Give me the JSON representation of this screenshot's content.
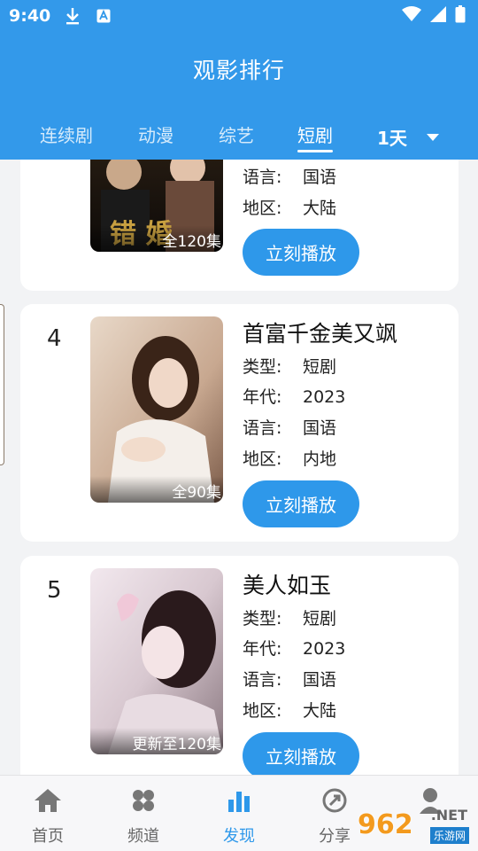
{
  "status_bar": {
    "time": "9:40"
  },
  "header": {
    "title": "观影排行"
  },
  "tabs": [
    {
      "label": "连续剧",
      "active": false
    },
    {
      "label": "动漫",
      "active": false
    },
    {
      "label": "综艺",
      "active": false
    },
    {
      "label": "短剧",
      "active": true
    }
  ],
  "period": {
    "label": "1天"
  },
  "items": [
    {
      "rank": "",
      "title": "",
      "type_label": "",
      "type": "",
      "year_label": "",
      "year": "",
      "lang_label": "语言:",
      "lang": "国语",
      "region_label": "地区:",
      "region": "大陆",
      "episodes": "全120集",
      "play_label": "立刻播放",
      "poster_text": "错 婚"
    },
    {
      "rank": "4",
      "title": "首富千金美又飒",
      "type_label": "类型:",
      "type": "短剧",
      "year_label": "年代:",
      "year": "2023",
      "lang_label": "语言:",
      "lang": "国语",
      "region_label": "地区:",
      "region": "内地",
      "episodes": "全90集",
      "play_label": "立刻播放"
    },
    {
      "rank": "5",
      "title": "美人如玉",
      "type_label": "类型:",
      "type": "短剧",
      "year_label": "年代:",
      "year": "2023",
      "lang_label": "语言:",
      "lang": "国语",
      "region_label": "地区:",
      "region": "大陆",
      "episodes": "更新至120集",
      "play_label": "立刻播放"
    }
  ],
  "bottom_nav": [
    {
      "label": "首页",
      "icon": "home-icon",
      "active": false
    },
    {
      "label": "频道",
      "icon": "channels-icon",
      "active": false
    },
    {
      "label": "发现",
      "icon": "chart-icon",
      "active": true
    },
    {
      "label": "分享",
      "icon": "share-icon",
      "active": false
    }
  ],
  "watermark": {
    "number": "962",
    "net": ".NET",
    "cn": "乐游网"
  },
  "colors": {
    "primary": "#3399ea",
    "button": "#2e98ea"
  }
}
